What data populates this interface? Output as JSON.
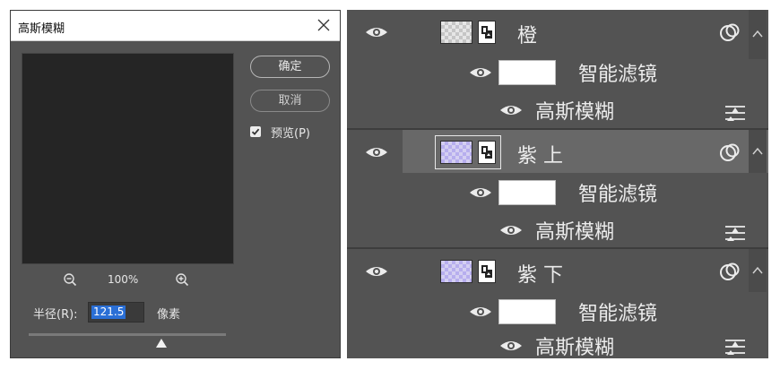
{
  "dialog": {
    "title": "高斯模糊",
    "ok_label": "确定",
    "cancel_label": "取消",
    "preview_label": "预览(P)",
    "preview_checked": true,
    "zoom_level": "100%",
    "radius_label": "半径(R):",
    "radius_value": "121.5",
    "radius_unit": "像素"
  },
  "layers": [
    {
      "name": "橙",
      "thumb": "plain",
      "filters_label": "智能滤镜",
      "filter": "高斯模糊",
      "selected": false
    },
    {
      "name": "紫 上",
      "thumb": "purple",
      "filters_label": "智能滤镜",
      "filter": "高斯模糊",
      "selected": true
    },
    {
      "name": "紫 下",
      "thumb": "purple",
      "filters_label": "智能滤镜",
      "filter": "高斯模糊",
      "selected": false
    }
  ],
  "icons": {
    "close": "close-icon",
    "zoom_out": "zoom-out-icon",
    "zoom_in": "zoom-in-icon",
    "eye": "eye-icon",
    "smart_object": "smart-object-icon",
    "fx": "fx-icon",
    "filter_options": "filter-options-icon"
  },
  "colors": {
    "panel": "#535353",
    "selected_row": "#686868",
    "accent": "#2a6fd6"
  }
}
